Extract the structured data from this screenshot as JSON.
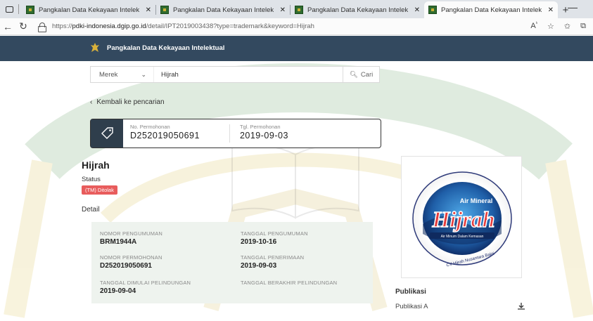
{
  "browser": {
    "tabs": [
      {
        "title": "Pangkalan Data Kekayaan Intelek",
        "active": false
      },
      {
        "title": "Pangkalan Data Kekayaan Intelek",
        "active": false
      },
      {
        "title": "Pangkalan Data Kekayaan Intelek",
        "active": false
      },
      {
        "title": "Pangkalan Data Kekayaan Intelek",
        "active": true
      }
    ],
    "url_prefix": "https://",
    "url_host": "pdki-indonesia.dgip.go.id",
    "url_path": "/detail/IPT2019003438?type=trademark&keyword=Hijrah"
  },
  "header": {
    "title": "Pangkalan Data Kekayaan Intelektual"
  },
  "search": {
    "category": "Merek",
    "query": "Hijrah",
    "button_label": "Cari"
  },
  "back_label": "Kembali ke pencarian",
  "application": {
    "no_label": "No. Permohonan",
    "no_value": "D252019050691",
    "date_label": "Tgl. Permohonan",
    "date_value": "2019-09-03"
  },
  "mark": {
    "name": "Hijrah",
    "status_label": "Status",
    "status_value": "(TM) Ditolak",
    "detail_label": "Detail"
  },
  "details": [
    {
      "key": "NOMOR PENGUMUMAN",
      "value": "BRM1944A"
    },
    {
      "key": "TANGGAL PENGUMUMAN",
      "value": "2019-10-16"
    },
    {
      "key": "NOMOR PERMOHONAN",
      "value": "D252019050691"
    },
    {
      "key": "TANGGAL PENERIMAAN",
      "value": "2019-09-03"
    },
    {
      "key": "TANGGAL DIMULAI PELINDUNGAN",
      "value": "2019-09-04"
    },
    {
      "key": "TANGGAL BERAKHIR PELINDUNGAN",
      "value": ""
    }
  ],
  "logo_image": {
    "brand_top": "Air Mineral",
    "brand_main": "Hijrah",
    "ribbon": "Air Minum Dalam Kemasan",
    "bottom_text": "CV Hijrah Nusantara Bakti"
  },
  "publication": {
    "label": "Publikasi",
    "item": "Publikasi A"
  },
  "colors": {
    "header_bg": "#33495f",
    "status_badge": "#e85c5c",
    "detail_bg": "#eef3ee"
  }
}
